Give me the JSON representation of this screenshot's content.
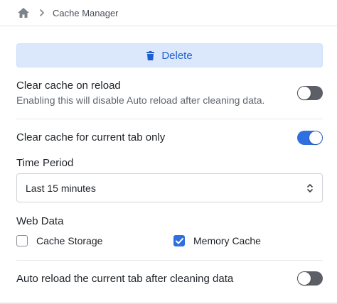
{
  "breadcrumb": {
    "page": "Cache Manager"
  },
  "delete_button": {
    "label": "Delete"
  },
  "clear_on_reload": {
    "title": "Clear cache on reload",
    "description": "Enabling this will disable Auto reload after cleaning data.",
    "enabled": false
  },
  "current_tab_only": {
    "title": "Clear cache for current tab only",
    "enabled": true
  },
  "time_period": {
    "label": "Time Period",
    "selected": "Last 15 minutes"
  },
  "web_data": {
    "label": "Web Data",
    "options": [
      {
        "label": "Cache Storage",
        "checked": false
      },
      {
        "label": "Memory Cache",
        "checked": true
      }
    ]
  },
  "auto_reload": {
    "title": "Auto reload the current tab after cleaning data",
    "enabled": false
  },
  "colors": {
    "accent": "#2f6fe0",
    "delete_bg": "#dbe8fb",
    "delete_text": "#1f5fd1",
    "toggle_off": "#5c6066"
  }
}
